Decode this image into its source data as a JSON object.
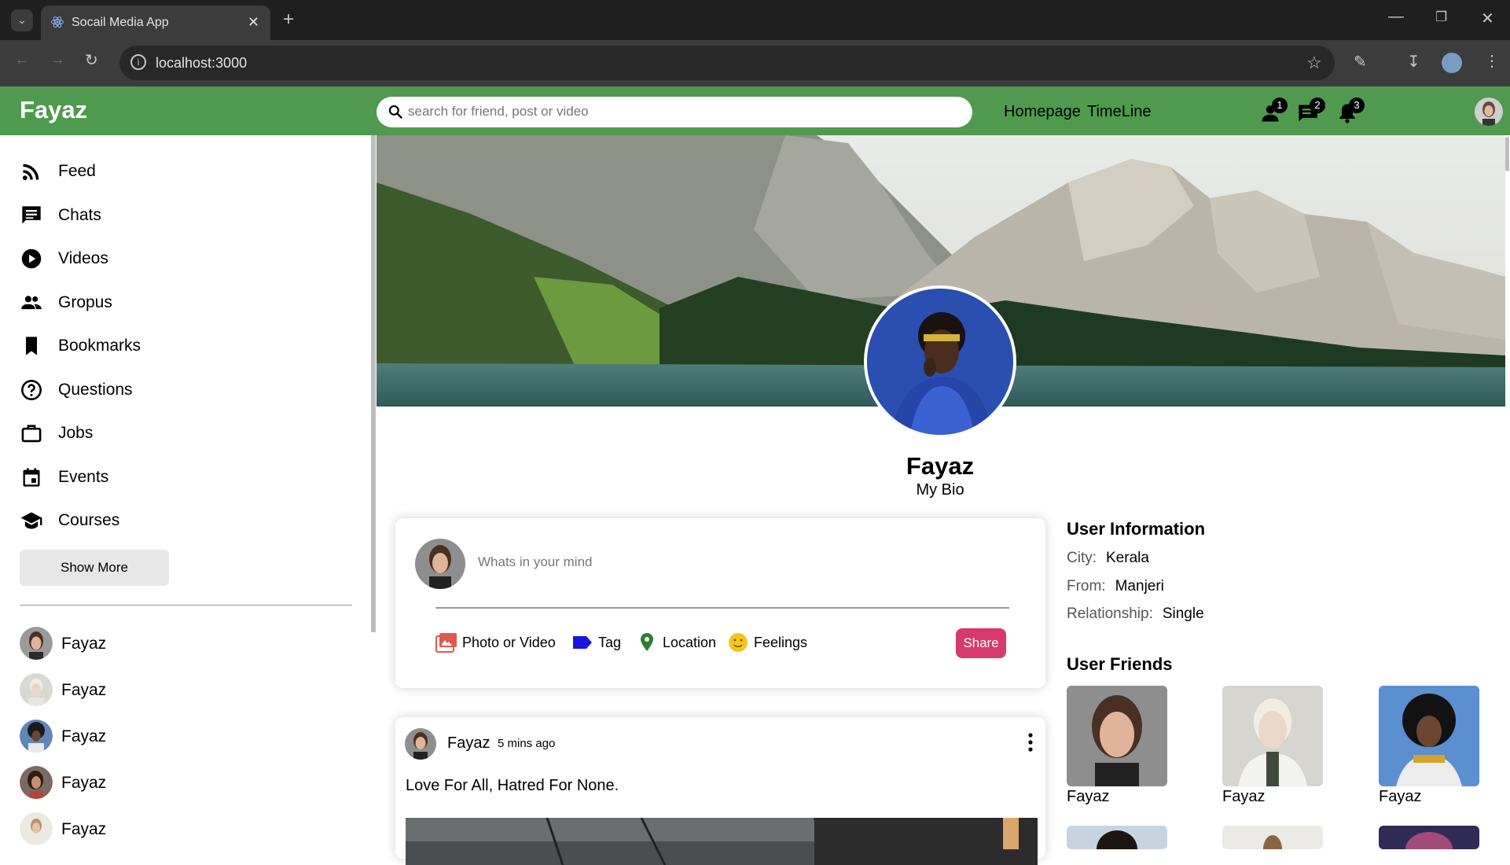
{
  "browser": {
    "tab_title": "Socail Media App",
    "url": "localhost:3000"
  },
  "header": {
    "brand": "Fayaz",
    "search_placeholder": "search for friend, post or video",
    "nav": [
      "Homepage",
      "TimeLine"
    ],
    "badges": {
      "friend_requests": "1",
      "messages": "2",
      "notifications": "3"
    }
  },
  "sidebar": {
    "items": [
      {
        "label": "Feed",
        "icon": "rss-feed-icon"
      },
      {
        "label": "Chats",
        "icon": "chat-icon"
      },
      {
        "label": "Videos",
        "icon": "play-circle-icon"
      },
      {
        "label": "Gropus",
        "icon": "group-icon"
      },
      {
        "label": "Bookmarks",
        "icon": "bookmark-icon"
      },
      {
        "label": "Questions",
        "icon": "help-circle-icon"
      },
      {
        "label": "Jobs",
        "icon": "briefcase-icon"
      },
      {
        "label": "Events",
        "icon": "calendar-icon"
      },
      {
        "label": "Courses",
        "icon": "school-icon"
      }
    ],
    "show_more": "Show More",
    "friends": [
      "Fayaz",
      "Fayaz",
      "Fayaz",
      "Fayaz",
      "Fayaz"
    ]
  },
  "profile": {
    "name": "Fayaz",
    "bio": "My Bio"
  },
  "share": {
    "placeholder": "Whats in your mind",
    "options": [
      "Photo or Video",
      "Tag",
      "Location",
      "Feelings"
    ],
    "button": "Share"
  },
  "post": {
    "username": "Fayaz",
    "time": "5 mins ago",
    "text": "Love For All, Hatred For None."
  },
  "user_info": {
    "title": "User Information",
    "city_label": "City:",
    "city": "Kerala",
    "from_label": "From:",
    "from": "Manjeri",
    "relationship_label": "Relationship:",
    "relationship": "Single"
  },
  "user_friends": {
    "title": "User Friends",
    "names": [
      "Fayaz",
      "Fayaz",
      "Fayaz"
    ]
  },
  "colors": {
    "appbar": "#4f9a4f",
    "share_button": "#d63a6c",
    "tag_icon": "#1a14e0",
    "location_icon": "#2e7d32",
    "photo_icon": "#e0584a",
    "feelings_icon": "#f5c518"
  }
}
